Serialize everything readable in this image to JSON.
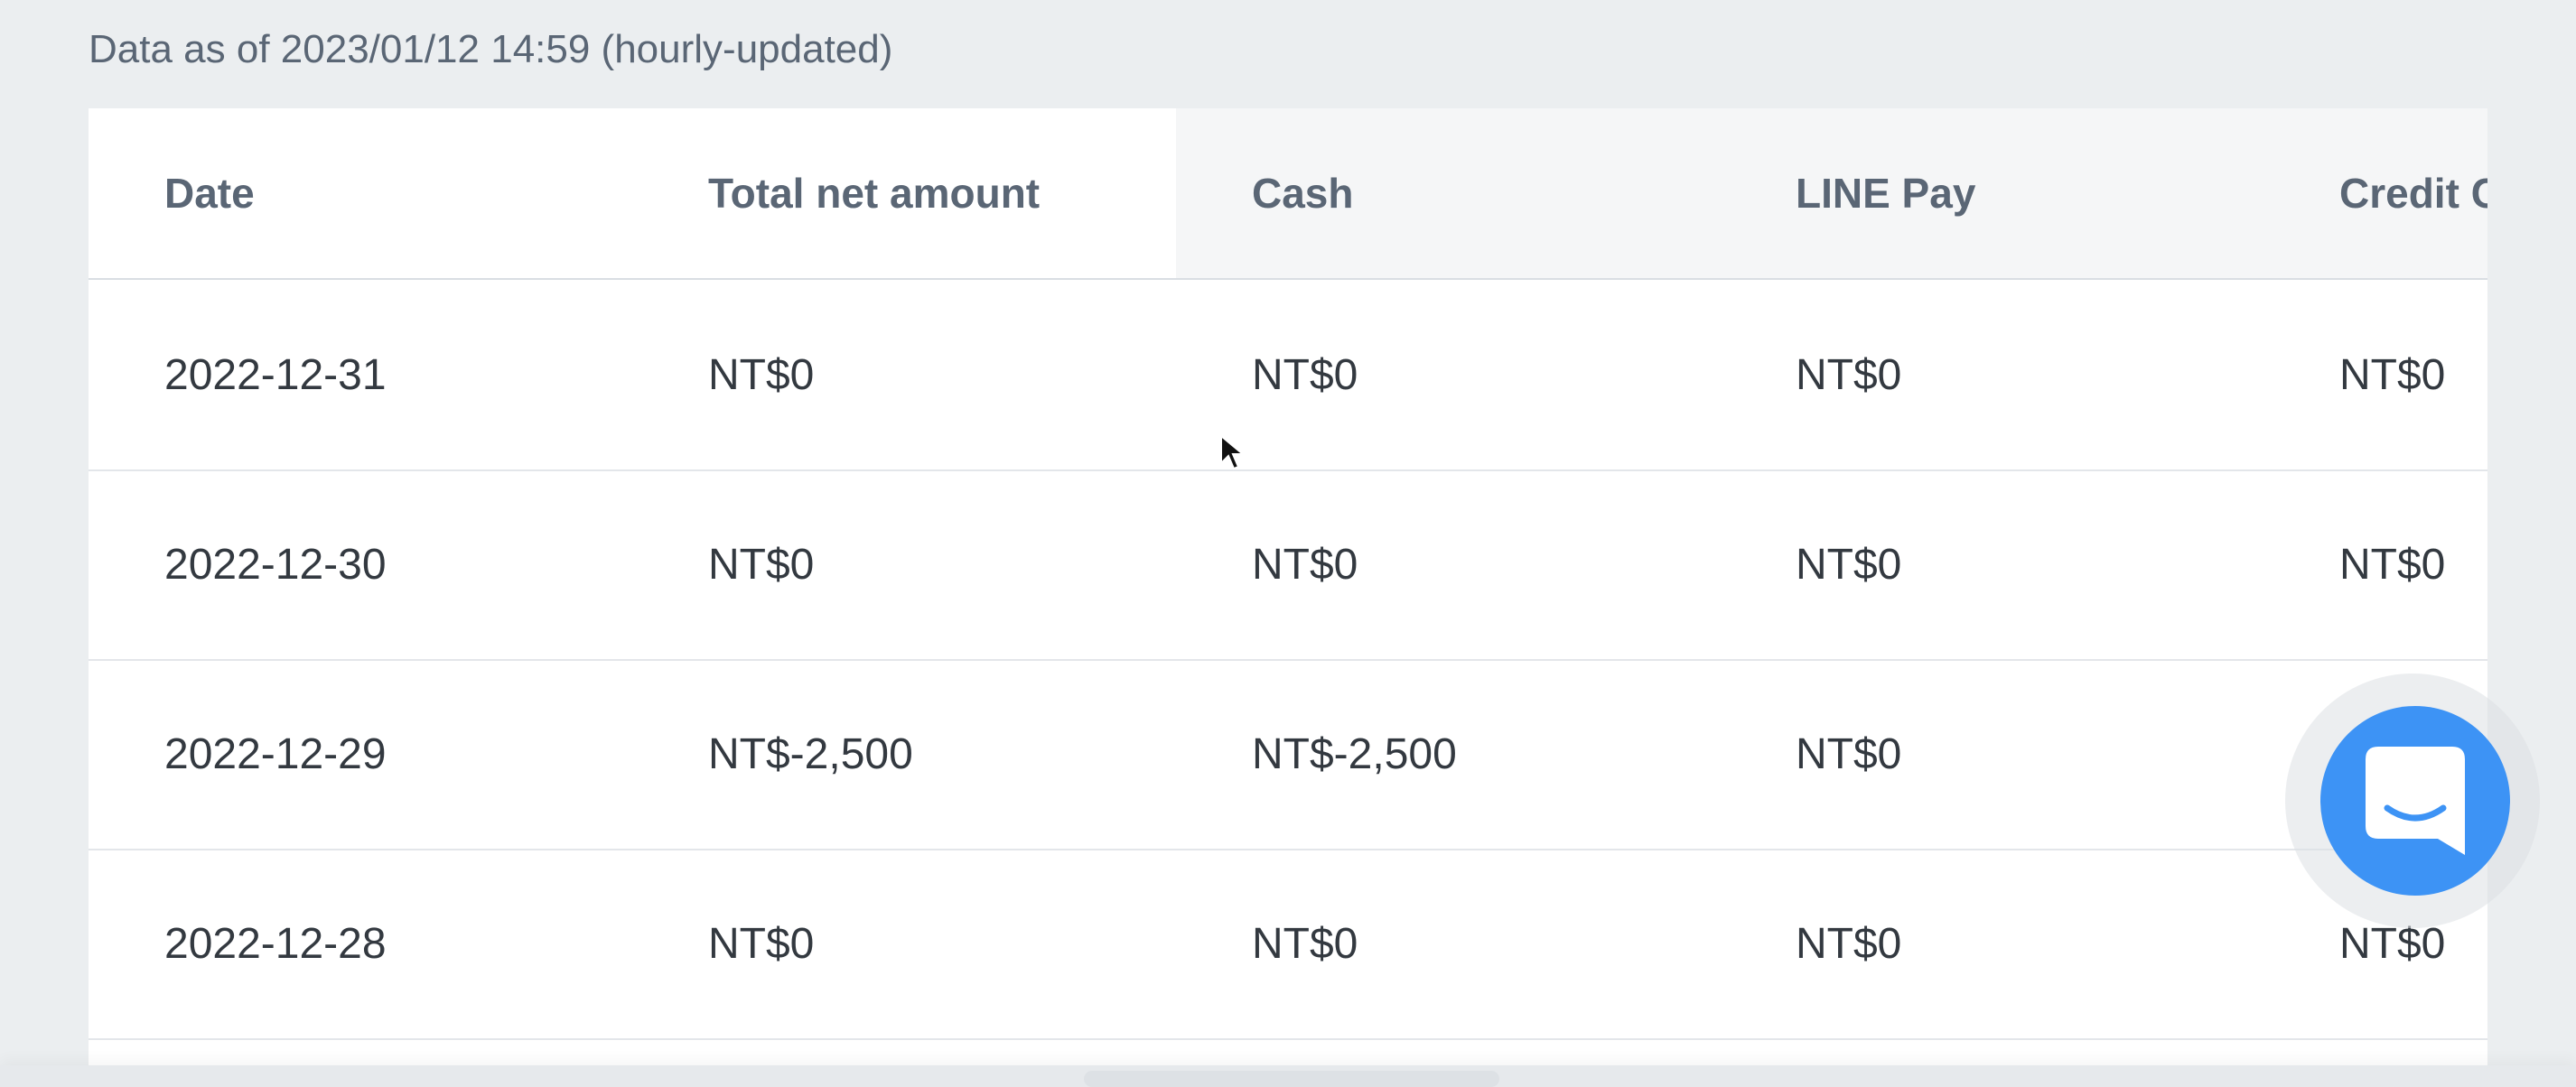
{
  "note": {
    "text": "Data as of 2023/01/12 14:59 (hourly-updated)"
  },
  "table": {
    "headers": [
      "Date",
      "Total net amount",
      "Cash",
      "LINE Pay",
      "Credit C"
    ],
    "rows": [
      [
        "2022-12-31",
        "NT$0",
        "NT$0",
        "NT$0",
        "NT$0"
      ],
      [
        "2022-12-30",
        "NT$0",
        "NT$0",
        "NT$0",
        "NT$0"
      ],
      [
        "2022-12-29",
        "NT$-2,500",
        "NT$-2,500",
        "NT$0",
        ""
      ],
      [
        "2022-12-28",
        "NT$0",
        "NT$0",
        "NT$0",
        "NT$0"
      ]
    ]
  },
  "icons": {
    "chat": "chat-bubble-icon",
    "cursor": "mouse-pointer-icon"
  },
  "colors": {
    "chat_accent": "#3d93f5",
    "background": "#ebeef0"
  }
}
